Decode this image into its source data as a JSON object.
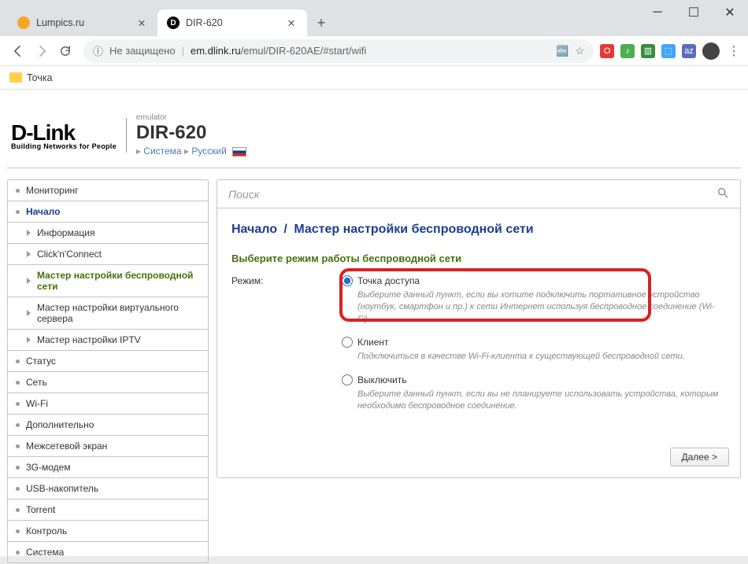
{
  "window": {
    "minimize": "—",
    "maximize": "☐",
    "close": "✕"
  },
  "tabs": [
    {
      "favColor": "#f7a623",
      "favText": "",
      "title": "Lumpics.ru",
      "active": false
    },
    {
      "favColor": "#000",
      "favText": "D",
      "title": "DIR-620",
      "active": true
    }
  ],
  "addr": {
    "insecure": "Не защищено",
    "url_host": "em.dlink.ru",
    "url_path": "/emul/DIR-620AE/#start/wifi"
  },
  "bookmarks": {
    "item1": "Точка"
  },
  "header": {
    "logo_main": "D-Link",
    "logo_sub": "Building Networks for People",
    "emulator": "emulator",
    "model": "DIR-620",
    "link_system": "Система",
    "link_lang": "Русский"
  },
  "sidebar": {
    "items": [
      {
        "label": "Мониторинг",
        "type": "top"
      },
      {
        "label": "Начало",
        "type": "top-expanded"
      },
      {
        "label": "Информация",
        "type": "sub"
      },
      {
        "label": "Click'n'Connect",
        "type": "sub"
      },
      {
        "label": "Мастер настройки беспроводной сети",
        "type": "sub-active"
      },
      {
        "label": "Мастер настройки виртуального сервера",
        "type": "sub"
      },
      {
        "label": "Мастер настройки IPTV",
        "type": "sub"
      },
      {
        "label": "Статус",
        "type": "top"
      },
      {
        "label": "Сеть",
        "type": "top"
      },
      {
        "label": "Wi-Fi",
        "type": "top"
      },
      {
        "label": "Дополнительно",
        "type": "top"
      },
      {
        "label": "Межсетевой экран",
        "type": "top"
      },
      {
        "label": "3G-модем",
        "type": "top"
      },
      {
        "label": "USB-накопитель",
        "type": "top"
      },
      {
        "label": "Torrent",
        "type": "top"
      },
      {
        "label": "Контроль",
        "type": "top"
      },
      {
        "label": "Система",
        "type": "top"
      }
    ]
  },
  "main": {
    "search_placeholder": "Поиск",
    "breadcrumb_root": "Начало",
    "breadcrumb_sep": "/",
    "breadcrumb_page": "Мастер настройки беспроводной сети",
    "section_title": "Выберите режим работы беспроводной сети",
    "mode_label": "Режим:",
    "options": [
      {
        "label": "Точка доступа",
        "desc": "Выберите данный пункт, если вы хотите подключить портативное устройство (ноутбук, смартфон и пр.) к сети Интернет используя беспроводное соединение (Wi-Fi).",
        "checked": true
      },
      {
        "label": "Клиент",
        "desc": "Подключиться в качестве Wi-Fi-клиента к существующей беспроводной сети.",
        "checked": false
      },
      {
        "label": "Выключить",
        "desc": "Выберите данный пункт, если вы не планируете использовать устройства, которым необходимо беспроводное соединение.",
        "checked": false
      }
    ],
    "next_button": "Далее >"
  }
}
